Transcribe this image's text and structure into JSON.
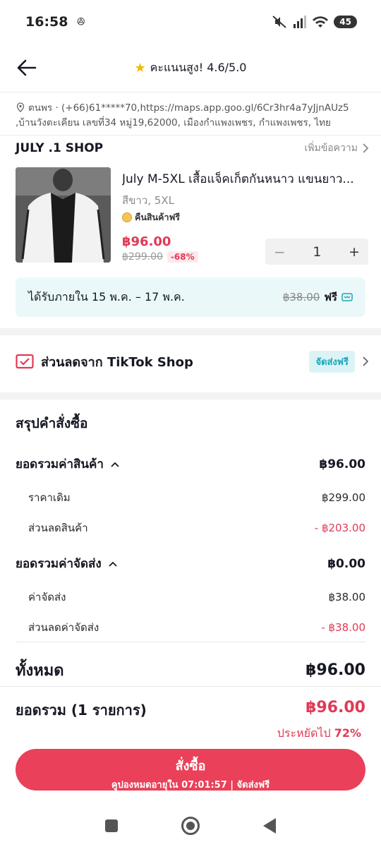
{
  "status_bar": {
    "time": "16:58",
    "left_icon": "ꔮ",
    "battery": "45"
  },
  "header": {
    "rating_text": "คะแนนสูง! 4.6/5.0"
  },
  "address": {
    "line1": "ตนพร · (+66)61*****70,https://maps.app.goo.gl/6Cr3hr4a7yJjnAUz5",
    "line2": ",บ้านวังตะเคียน เลขที่34 หมู่19,62000, เมืองกำแพงเพชร, กำแพงเพชร, ไทย"
  },
  "shop": {
    "name": "JULY .1 SHOP",
    "message_link": "เพิ่มข้อความ"
  },
  "product": {
    "title": "July M-5XL เสื้อแจ็คเก็ตกันหนาว แขนยาว...",
    "variant": "สีขาว, 5XL",
    "return_badge": "คืนสินค้าฟรี",
    "price": "฿96.00",
    "original_price": "฿299.00",
    "discount": "-68%",
    "quantity": "1",
    "minus": "−",
    "plus": "+"
  },
  "delivery": {
    "text": "ได้รับภายใน 15 พ.ค. – 17 พ.ค.",
    "old_fee": "฿38.00",
    "free": "ฟรี"
  },
  "tiktok_discount": {
    "label": "ส่วนลดจาก TikTok Shop",
    "tag": "จัดส่งฟรี"
  },
  "summary": {
    "title": "สรุปคำสั่งซื้อ",
    "product_total_label": "ยอดรวมค่าสินค้า",
    "product_total_value": "฿96.00",
    "original_price_label": "ราคาเดิม",
    "original_price_value": "฿299.00",
    "product_discount_label": "ส่วนลดสินค้า",
    "product_discount_value": "- ฿203.00",
    "shipping_total_label": "ยอดรวมค่าจัดส่ง",
    "shipping_total_value": "฿0.00",
    "shipping_fee_label": "ค่าจัดส่ง",
    "shipping_fee_value": "฿38.00",
    "shipping_discount_label": "ส่วนลดค่าจัดส่ง",
    "shipping_discount_value": "- ฿38.00",
    "total_label": "ทั้งหมด",
    "total_value": "฿96.00"
  },
  "footer": {
    "grand_label": "ยอดรวม (1 รายการ)",
    "grand_value": "฿96.00",
    "saved_prefix": "ประหยัดไป",
    "saved_percent": "72%",
    "button_label": "สั่งซื้อ",
    "button_sub": "คูปองหมดอายุใน 07:01:57 | จัดส่งฟรี"
  },
  "colors": {
    "accent": "#ea4059",
    "price_red": "#e03a54",
    "teal": "#1aa6b7",
    "star": "#f5b800"
  },
  "icons": [
    "back-arrow-icon",
    "star-icon",
    "location-pin-icon",
    "chevron-right-icon",
    "coin-icon",
    "shipping-voucher-icon",
    "tiktok-voucher-icon",
    "chevron-up-icon",
    "nav-recents-icon",
    "nav-home-icon",
    "nav-back-icon"
  ]
}
